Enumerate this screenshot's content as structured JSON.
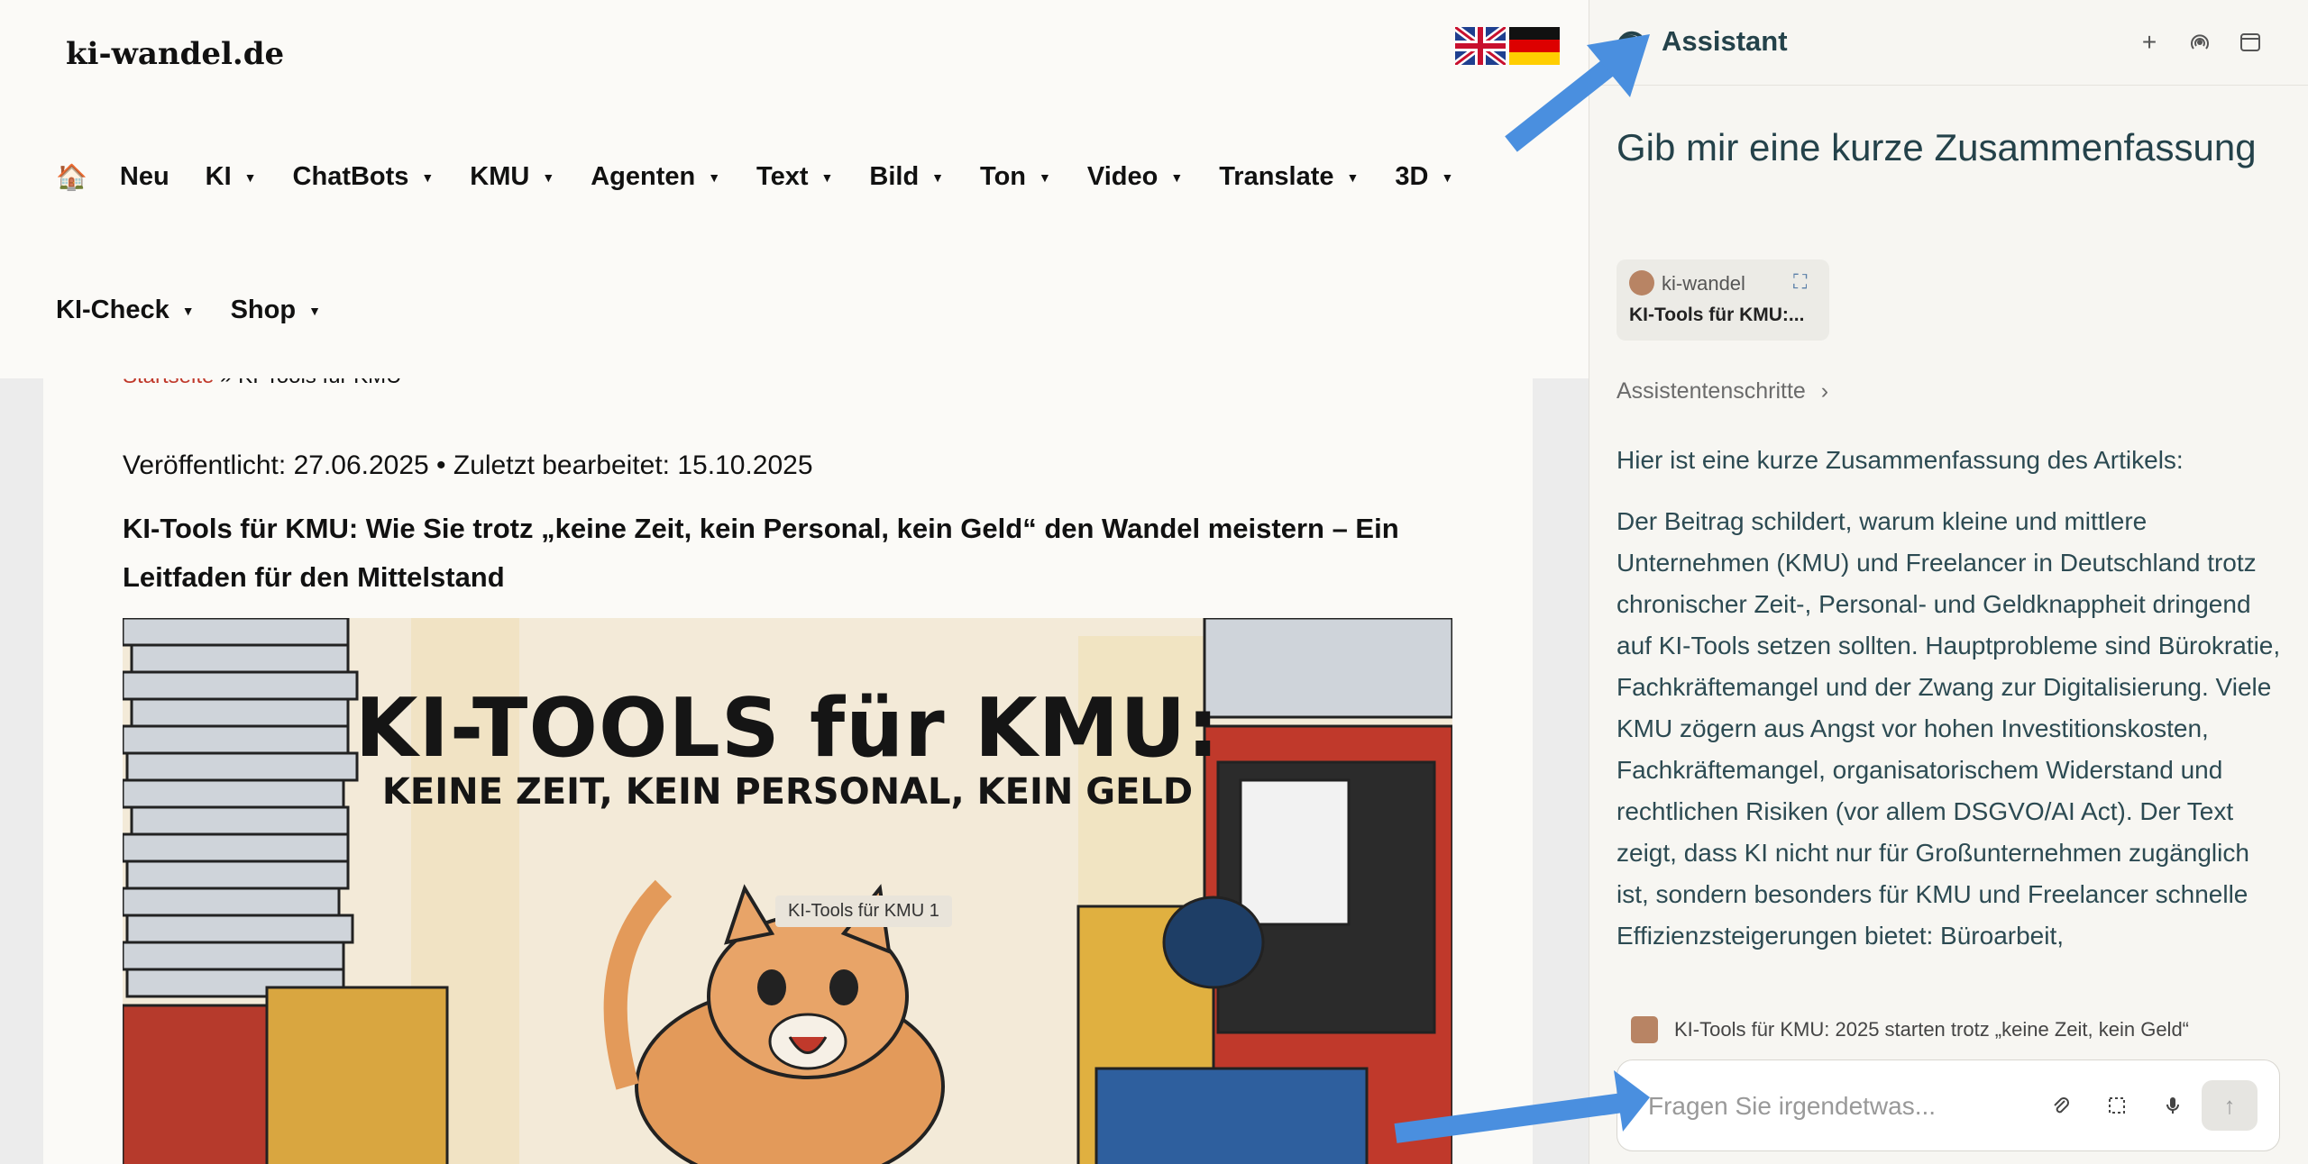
{
  "site": {
    "logo": "ki-wandel.de",
    "nav_row1": [
      "Neu",
      "KI",
      "ChatBots",
      "KMU",
      "Agenten",
      "Text",
      "Bild",
      "Ton",
      "Video",
      "Translate",
      "3D"
    ],
    "nav_row1_has_caret": [
      false,
      true,
      true,
      true,
      true,
      true,
      true,
      true,
      true,
      true,
      true
    ],
    "nav_row2": [
      "KI-Check",
      "Shop"
    ],
    "home_icon": "🏠",
    "breadcrumb_link": "Startseite",
    "breadcrumb_sep": " » ",
    "breadcrumb_current": "KI-Tools für KMU",
    "published": "Veröffentlicht: 27.06.2025 • Zuletzt bearbeitet: 15.10.2025",
    "article_title": "KI-Tools für KMU: Wie Sie trotz „keine Zeit, kein Personal, kein Geld“ den Wandel meistern – Ein Leitfaden für den Mittelstand",
    "hero_title": "KI-TOOLS für KMU:",
    "hero_subtitle": "KEINE ZEIT, KEIN PERSONAL, KEIN GELD",
    "hero_tooltip": "KI-Tools für KMU 1"
  },
  "panel": {
    "title": "Assistant",
    "question": "Gib mir eine kurze Zusammenfassung",
    "source": {
      "name": "ki-wandel",
      "title": "KI-Tools für KMU:..."
    },
    "steps_label": "Assistentenschritte",
    "answer_intro": "Hier ist eine kurze Zusammenfassung des Artikels:",
    "answer_body": "Der Beitrag schildert, warum kleine und mittlere Unternehmen (KMU) und Freelancer in Deutschland trotz chronischer Zeit-, Personal- und Geldknappheit dringend auf KI-Tools setzen sollten. Hauptprobleme sind Bürokratie, Fachkräftemangel und der Zwang zur Digitalisierung. Viele KMU zögern aus Angst vor hohen Investitionskosten, Fachkräftemangel, organisatorischem Widerstand und rechtlichen Risiken (vor allem DSGVO/AI Act). Der Text zeigt, dass KI nicht nur für Großunternehmen zugänglich ist, sondern besonders für KMU und Freelancer schnelle Effizienzsteigerungen bietet: Büroarbeit,",
    "context_chip": "KI-Tools für KMU: 2025 starten trotz „keine Zeit, kein Geld“",
    "input_placeholder": "Fragen Sie irgendetwas...",
    "icons": {
      "header": [
        "plus-icon",
        "broadcast-icon",
        "window-icon"
      ],
      "input": [
        "paperclip-icon",
        "screenshot-select-icon",
        "microphone-icon",
        "send-arrow-icon"
      ]
    }
  },
  "colors": {
    "panel_text": "#24424a",
    "arrow": "#4a8fdf",
    "breadcrumb_link": "#c0392b"
  }
}
